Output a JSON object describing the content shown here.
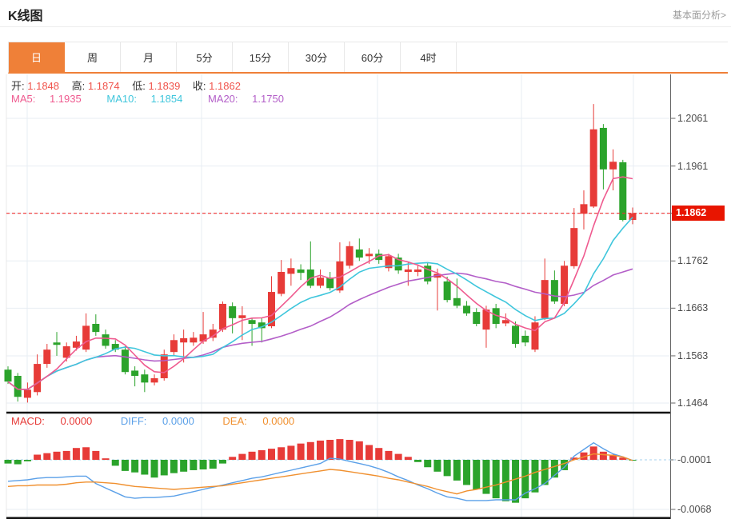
{
  "header": {
    "title": "K线图",
    "analysis_link": "基本面分析>"
  },
  "tabs": [
    {
      "label": "日",
      "active": true
    },
    {
      "label": "周",
      "active": false
    },
    {
      "label": "月",
      "active": false
    },
    {
      "label": "5分",
      "active": false
    },
    {
      "label": "15分",
      "active": false
    },
    {
      "label": "30分",
      "active": false
    },
    {
      "label": "60分",
      "active": false
    },
    {
      "label": "4时",
      "active": false
    }
  ],
  "info": {
    "open_label": "开:",
    "open": "1.1848",
    "high_label": "高:",
    "high": "1.1874",
    "low_label": "低:",
    "low": "1.1839",
    "close_label": "收:",
    "close": "1.1862",
    "ma5_label": "MA5:",
    "ma5": "1.1935",
    "ma10_label": "MA10:",
    "ma10": "1.1854",
    "ma20_label": "MA20:",
    "ma20": "1.1750"
  },
  "macd_info": {
    "macd_label": "MACD:",
    "macd": "0.0000",
    "diff_label": "DIFF:",
    "diff": "0.0000",
    "dea_label": "DEA:",
    "dea": "0.0000"
  },
  "colors": {
    "up": "#e73b38",
    "down": "#2ba32b",
    "ma5": "#ef5a8f",
    "ma10": "#3fc6dc",
    "ma20": "#b35ec8",
    "diff_line": "#5ba0e8",
    "dea_line": "#f0902f",
    "accent": "#ef8038",
    "price_line": "#f03030",
    "price_label_bg": "#e81500",
    "grid": "#e7edf3",
    "axis": "#666666",
    "divider": "#111111",
    "baseline_dashed": "#a5d2ee",
    "ohlc_value": "#f0544c"
  },
  "chart_data": {
    "type": "candlestick+macd",
    "main_panel": {
      "y_axis_ticks": [
        "1.2061",
        "1.1961",
        "1.1862",
        "1.1762",
        "1.1663",
        "1.1563",
        "1.1464"
      ],
      "current_price": "1.1862",
      "current_price_value": 1.1862,
      "ma_periods": [
        5,
        10,
        20
      ],
      "candles_ohlc": [
        [
          1.1534,
          1.1541,
          1.1504,
          1.1509
        ],
        [
          1.1521,
          1.1527,
          1.1467,
          1.1477
        ],
        [
          1.1475,
          1.1507,
          1.1465,
          1.1492
        ],
        [
          1.1487,
          1.1566,
          1.148,
          1.1546
        ],
        [
          1.1546,
          1.1588,
          1.1538,
          1.1576
        ],
        [
          1.1591,
          1.1613,
          1.1563,
          1.1586
        ],
        [
          1.1559,
          1.1591,
          1.1551,
          1.1583
        ],
        [
          1.158,
          1.1605,
          1.1574,
          1.1593
        ],
        [
          1.1576,
          1.1652,
          1.1571,
          1.1626
        ],
        [
          1.163,
          1.165,
          1.1605,
          1.1613
        ],
        [
          1.1608,
          1.1618,
          1.1578,
          1.1584
        ],
        [
          1.1588,
          1.1596,
          1.1571,
          1.1576
        ],
        [
          1.1576,
          1.1583,
          1.1524,
          1.1529
        ],
        [
          1.1532,
          1.1541,
          1.1499,
          1.1521
        ],
        [
          1.1524,
          1.1534,
          1.1487,
          1.1507
        ],
        [
          1.1507,
          1.1524,
          1.1501,
          1.1516
        ],
        [
          1.1516,
          1.1576,
          1.1511,
          1.1566
        ],
        [
          1.1571,
          1.1608,
          1.1564,
          1.1596
        ],
        [
          1.1591,
          1.1618,
          1.1549,
          1.16
        ],
        [
          1.1591,
          1.1613,
          1.1584,
          1.1601
        ],
        [
          1.1593,
          1.1655,
          1.1588,
          1.1608
        ],
        [
          1.1601,
          1.163,
          1.1594,
          1.1618
        ],
        [
          1.1618,
          1.1677,
          1.1613,
          1.1672
        ],
        [
          1.1667,
          1.1675,
          1.161,
          1.1642
        ],
        [
          1.1642,
          1.1667,
          1.1596,
          1.1648
        ],
        [
          1.1638,
          1.1643,
          1.1584,
          1.163
        ],
        [
          1.1633,
          1.1642,
          1.1591,
          1.1621
        ],
        [
          1.1625,
          1.173,
          1.1621,
          1.1697
        ],
        [
          1.1693,
          1.1764,
          1.1688,
          1.1739
        ],
        [
          1.1735,
          1.1767,
          1.171,
          1.1747
        ],
        [
          1.1744,
          1.1755,
          1.1722,
          1.1737
        ],
        [
          1.1744,
          1.1803,
          1.1705,
          1.171
        ],
        [
          1.171,
          1.1744,
          1.1705,
          1.1727
        ],
        [
          1.1727,
          1.1739,
          1.17,
          1.1705
        ],
        [
          1.17,
          1.1801,
          1.1695,
          1.1761
        ],
        [
          1.1752,
          1.1803,
          1.1746,
          1.1793
        ],
        [
          1.1786,
          1.1809,
          1.1762,
          1.1769
        ],
        [
          1.1772,
          1.1789,
          1.1756,
          1.1777
        ],
        [
          1.1777,
          1.1786,
          1.1756,
          1.1764
        ],
        [
          1.1747,
          1.1777,
          1.174,
          1.1772
        ],
        [
          1.1769,
          1.1777,
          1.1735,
          1.1742
        ],
        [
          1.1739,
          1.1759,
          1.171,
          1.1744
        ],
        [
          1.1739,
          1.1755,
          1.173,
          1.1744
        ],
        [
          1.1752,
          1.1759,
          1.1713,
          1.1719
        ],
        [
          1.1727,
          1.1746,
          1.1658,
          1.1735
        ],
        [
          1.1719,
          1.1729,
          1.1675,
          1.168
        ],
        [
          1.1684,
          1.1725,
          1.1663,
          1.1668
        ],
        [
          1.1668,
          1.1678,
          1.1647,
          1.1652
        ],
        [
          1.1655,
          1.1663,
          1.1625,
          1.163
        ],
        [
          1.1618,
          1.1668,
          1.158,
          1.166
        ],
        [
          1.1663,
          1.1672,
          1.1621,
          1.163
        ],
        [
          1.1631,
          1.1652,
          1.1625,
          1.1638
        ],
        [
          1.1626,
          1.1635,
          1.158,
          1.1588
        ],
        [
          1.1605,
          1.1616,
          1.1583,
          1.1591
        ],
        [
          1.1576,
          1.1646,
          1.1571,
          1.1633
        ],
        [
          1.1642,
          1.1767,
          1.1638,
          1.1722
        ],
        [
          1.1722,
          1.1742,
          1.1672,
          1.1677
        ],
        [
          1.1672,
          1.1762,
          1.1667,
          1.1752
        ],
        [
          1.1751,
          1.1873,
          1.1746,
          1.1831
        ],
        [
          1.1861,
          1.191,
          1.1828,
          1.1881
        ],
        [
          1.1876,
          1.2091,
          1.1873,
          1.2038
        ],
        [
          1.2041,
          1.2049,
          1.1912,
          1.1954
        ],
        [
          1.1954,
          1.1996,
          1.191,
          1.197
        ],
        [
          1.1969,
          1.1974,
          1.1845,
          1.1848
        ],
        [
          1.1848,
          1.1874,
          1.1839,
          1.1862
        ]
      ]
    },
    "macd_panel": {
      "y_axis_ticks": [
        "-0.0001",
        "-0.0068"
      ],
      "hist": [
        -0.0005,
        -0.0006,
        -0.0002,
        0.0007,
        0.0009,
        0.0011,
        0.0012,
        0.0016,
        0.0017,
        0.0012,
        0.0002,
        -0.0008,
        -0.0015,
        -0.0017,
        -0.002,
        -0.0024,
        -0.0021,
        -0.0018,
        -0.0016,
        -0.0014,
        -0.0013,
        -0.0012,
        -0.0005,
        0.0004,
        0.0008,
        0.0011,
        0.0013,
        0.0015,
        0.0017,
        0.0019,
        0.0022,
        0.0024,
        0.0026,
        0.0027,
        0.0028,
        0.0027,
        0.0025,
        0.002,
        0.0016,
        0.0012,
        0.0008,
        0.0004,
        -0.0003,
        -0.001,
        -0.0016,
        -0.0022,
        -0.0028,
        -0.0034,
        -0.004,
        -0.0046,
        -0.0052,
        -0.0056,
        -0.0058,
        -0.0052,
        -0.0044,
        -0.0034,
        -0.0024,
        -0.0014,
        0.0003,
        0.001,
        0.0018,
        0.0011,
        0.0007,
        0.0003,
        -0.0001
      ],
      "diff": [
        -0.0029,
        -0.0028,
        -0.0027,
        -0.0025,
        -0.0024,
        -0.0024,
        -0.0023,
        -0.0022,
        -0.0022,
        -0.0032,
        -0.0038,
        -0.0044,
        -0.005,
        -0.0052,
        -0.0051,
        -0.0051,
        -0.005,
        -0.0049,
        -0.0046,
        -0.0043,
        -0.004,
        -0.0037,
        -0.0034,
        -0.0031,
        -0.0028,
        -0.0025,
        -0.0023,
        -0.002,
        -0.0017,
        -0.0014,
        -0.0011,
        -0.0008,
        -0.0005,
        0.0002,
        0.0001,
        -0.0002,
        -0.0005,
        -0.0008,
        -0.0012,
        -0.0017,
        -0.0023,
        -0.0028,
        -0.0034,
        -0.0039,
        -0.0045,
        -0.005,
        -0.0052,
        -0.0055,
        -0.0055,
        -0.0055,
        -0.0054,
        -0.0054,
        -0.0054,
        -0.0045,
        -0.0039,
        -0.0032,
        -0.0021,
        -0.001,
        0.0005,
        0.0014,
        0.0023,
        0.0015,
        0.0008,
        0.0004,
        -0.0001
      ],
      "dea": [
        -0.0036,
        -0.0035,
        -0.0035,
        -0.0034,
        -0.0034,
        -0.0034,
        -0.0033,
        -0.0031,
        -0.003,
        -0.003,
        -0.0031,
        -0.0032,
        -0.0034,
        -0.0036,
        -0.0037,
        -0.0038,
        -0.0039,
        -0.004,
        -0.0039,
        -0.0038,
        -0.0037,
        -0.0036,
        -0.0035,
        -0.0033,
        -0.0031,
        -0.0029,
        -0.0027,
        -0.0025,
        -0.0023,
        -0.0021,
        -0.0019,
        -0.0017,
        -0.0015,
        -0.0013,
        -0.0014,
        -0.0016,
        -0.0018,
        -0.002,
        -0.0022,
        -0.0025,
        -0.0027,
        -0.003,
        -0.0033,
        -0.0036,
        -0.004,
        -0.0043,
        -0.0046,
        -0.0042,
        -0.004,
        -0.0037,
        -0.0034,
        -0.003,
        -0.0026,
        -0.0022,
        -0.0017,
        -0.0013,
        -0.0009,
        -0.0005,
        0.0,
        0.0004,
        0.0008,
        0.0007,
        0.0006,
        0.0004,
        -0.0001
      ]
    }
  }
}
